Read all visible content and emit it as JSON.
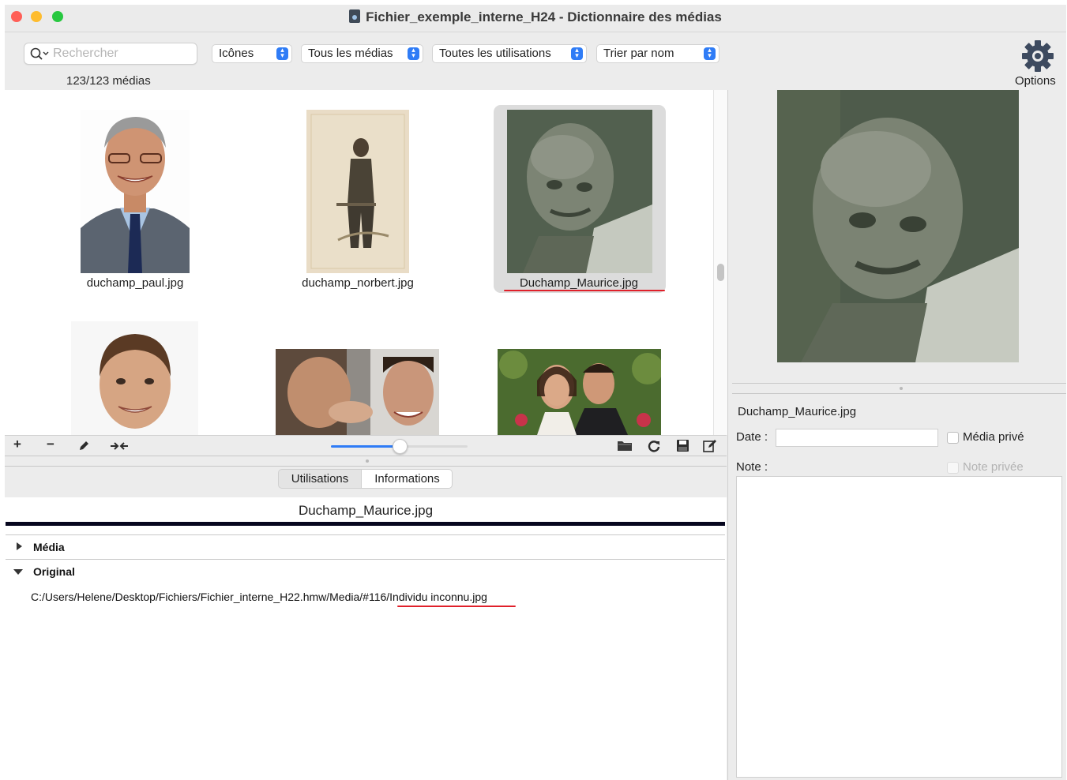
{
  "window": {
    "title": "Fichier_exemple_interne_H24 - Dictionnaire des médias"
  },
  "toolbar": {
    "search_placeholder": "Rechercher",
    "view_mode": "Icônes",
    "media_filter": "Tous les médias",
    "usage_filter": "Toutes les utilisations",
    "sort": "Trier par nom",
    "count": "123/123 médias",
    "options_label": "Options"
  },
  "grid": {
    "items": [
      {
        "label": "duchamp_paul.jpg"
      },
      {
        "label": "duchamp_norbert.jpg"
      },
      {
        "label": "Duchamp_Maurice.jpg",
        "selected": true
      },
      {
        "label": ""
      },
      {
        "label": ""
      },
      {
        "label": ""
      }
    ],
    "zoom_fraction": 0.5
  },
  "grid_toolbar": {
    "icons": [
      "add-icon",
      "remove-icon",
      "edit-pencil-icon",
      "merge-icon",
      "folder-icon",
      "refresh-icon",
      "save-icon",
      "edit-note-icon"
    ]
  },
  "tabs": [
    {
      "label": "Utilisations"
    },
    {
      "label": "Informations",
      "active": true
    }
  ],
  "info": {
    "title": "Duchamp_Maurice.jpg",
    "sections": [
      {
        "label": "Média",
        "expanded": false
      },
      {
        "label": "Original",
        "expanded": true
      }
    ],
    "original_path": "C:/Users/Helene/Desktop/Fichiers/Fichier_interne_H22.hmw/Media/#116/Individu inconnu.jpg"
  },
  "detail": {
    "filename": "Duchamp_Maurice.jpg",
    "date_label": "Date :",
    "date_value": "",
    "private_media_label": "Média privé",
    "note_label": "Note :",
    "private_note_label": "Note privée"
  },
  "colors": {
    "accent": "#2f7cf6",
    "annotation_red": "#e0202a",
    "close": "#ff5f57",
    "minimize": "#febc2e",
    "zoom": "#28c840"
  }
}
